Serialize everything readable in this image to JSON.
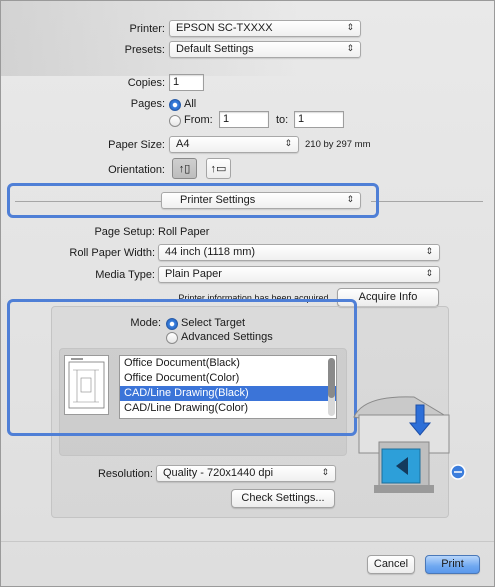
{
  "printer": {
    "label": "Printer:",
    "value": "EPSON SC-TXXXX"
  },
  "presets": {
    "label": "Presets:",
    "value": "Default Settings"
  },
  "copies": {
    "label": "Copies:",
    "value": "1"
  },
  "pages": {
    "label": "Pages:",
    "all_label": "All",
    "from_label": "From:",
    "from_value": "1",
    "to_label": "to:",
    "to_value": "1"
  },
  "paper_size": {
    "label": "Paper Size:",
    "value": "A4",
    "dimensions": "210 by 297 mm"
  },
  "orientation": {
    "label": "Orientation:"
  },
  "panel_select": {
    "value": "Printer Settings"
  },
  "page_setup": {
    "label": "Page Setup:",
    "value": "Roll Paper"
  },
  "roll_paper_width": {
    "label": "Roll Paper Width:",
    "value": "44 inch (1118 mm)"
  },
  "media_type": {
    "label": "Media Type:",
    "value": "Plain Paper"
  },
  "printer_info": {
    "text": "Printer information has been acquired.",
    "button": "Acquire Info"
  },
  "mode": {
    "label": "Mode:",
    "option_select_target": "Select Target",
    "option_advanced": "Advanced Settings"
  },
  "target_list": {
    "items": [
      "Office Document(Black)",
      "Office Document(Color)",
      "CAD/Line Drawing(Black)",
      "CAD/Line Drawing(Color)"
    ],
    "selected_index": 2
  },
  "resolution": {
    "label": "Resolution:",
    "value": "Quality - 720x1440 dpi"
  },
  "check_settings": {
    "label": "Check Settings..."
  },
  "footer": {
    "cancel": "Cancel",
    "print": "Print"
  },
  "colors": {
    "highlight": "#4f7fd6",
    "selection": "#3b74d8"
  }
}
